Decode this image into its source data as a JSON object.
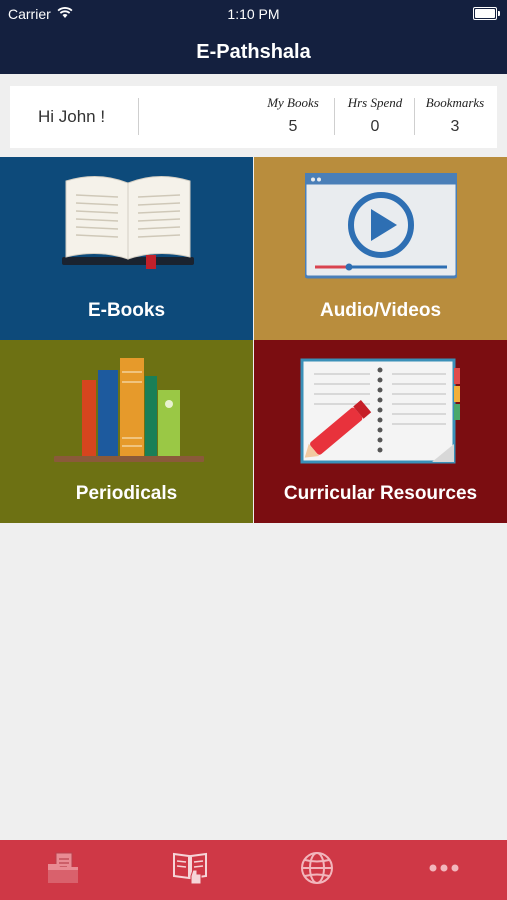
{
  "status_bar": {
    "carrier": "Carrier",
    "time": "1:10 PM"
  },
  "header": {
    "title": "E-Pathshala"
  },
  "stats": {
    "greeting": "Hi John !",
    "items": [
      {
        "label": "My Books",
        "value": "5"
      },
      {
        "label": "Hrs Spend",
        "value": "0"
      },
      {
        "label": "Bookmarks",
        "value": "3"
      }
    ]
  },
  "tiles": [
    {
      "label": "E-Books",
      "icon": "open-book-icon",
      "color": "#0d4a7a"
    },
    {
      "label": "Audio/Videos",
      "icon": "video-player-icon",
      "color": "#b98d3d"
    },
    {
      "label": "Periodicals",
      "icon": "books-shelf-icon",
      "color": "#6d7113"
    },
    {
      "label": "Curricular Resources",
      "icon": "notebook-pen-icon",
      "color": "#7b0d11"
    }
  ],
  "tabbar": {
    "color": "#cf3846",
    "tabs": [
      {
        "icon": "folder-document-icon"
      },
      {
        "icon": "reader-book-icon"
      },
      {
        "icon": "globe-icon"
      },
      {
        "icon": "more-icon"
      }
    ]
  }
}
